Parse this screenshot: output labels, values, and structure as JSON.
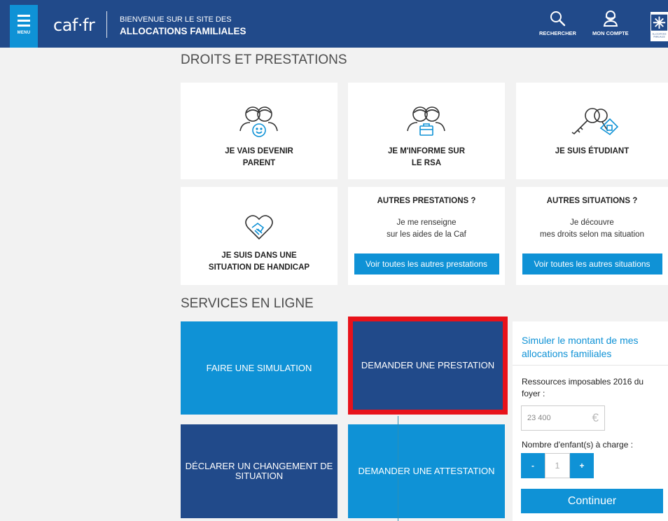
{
  "header": {
    "menu_label": "MENU",
    "logo_text": "caf·fr",
    "welcome_line1": "BIENVENUE SUR LE SITE DES",
    "welcome_line2": "ALLOCATIONS FAMILIALES",
    "search_label": "RECHERCHER",
    "account_label": "MON COMPTE",
    "logo_badge_text": "ALLOCATIONS FAMILIALES"
  },
  "droits": {
    "section_title": "DROITS ET PRESTATIONS",
    "cards": [
      {
        "title_line1": "JE VAIS DEVENIR",
        "title_line2": "PARENT",
        "icon": "parents-baby-icon"
      },
      {
        "title_line1": "JE M'INFORME SUR",
        "title_line2": "LE RSA",
        "icon": "people-briefcase-icon"
      },
      {
        "title_line1": "JE SUIS ÉTUDIANT",
        "title_line2": "",
        "icon": "key-house-icon"
      },
      {
        "title_line1": "JE SUIS DANS UNE",
        "title_line2": "SITUATION DE HANDICAP",
        "icon": "heart-handshake-icon"
      }
    ],
    "autres_prestations": {
      "title": "AUTRES PRESTATIONS ?",
      "desc_line1": "Je me renseigne",
      "desc_line2": "sur les aides de la Caf",
      "button": "Voir toutes les autres prestations"
    },
    "autres_situations": {
      "title": "AUTRES SITUATIONS ?",
      "desc_line1": "Je découvre",
      "desc_line2": "mes droits selon ma situation",
      "button": "Voir toutes les autres situations"
    }
  },
  "services": {
    "section_title": "SERVICES EN LIGNE",
    "tiles": {
      "simulation": "FAIRE UNE SIMULATION",
      "prestation": "DEMANDER UNE PRESTATION",
      "changement_line1": "DÉCLARER UN CHANGEMENT DE",
      "changement_line2": "SITUATION",
      "attestation": "DEMANDER UNE ATTESTATION"
    }
  },
  "simulator": {
    "title_line1": "Simuler le montant de mes",
    "title_line2": "allocations familiales",
    "resources_label_line1": "Ressources imposables 2016 du",
    "resources_label_line2": "foyer :",
    "resources_value": "23 400",
    "currency": "€",
    "children_label": "Nombre d'enfant(s) à charge :",
    "minus": "-",
    "children_value": "1",
    "plus": "+",
    "continue": "Continuer"
  },
  "colors": {
    "header": "#214a8a",
    "accent": "#0f92d6",
    "highlight": "#e8121a"
  }
}
